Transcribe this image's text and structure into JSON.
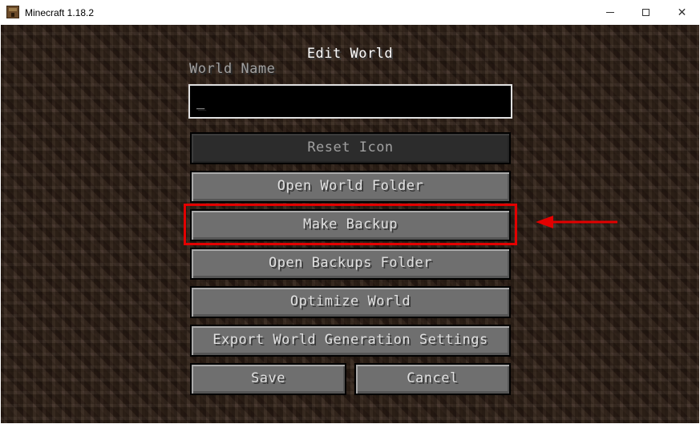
{
  "window": {
    "title": "Minecraft 1.18.2",
    "icon": "minecraft-block-icon",
    "controls": {
      "minimize_icon": "minimize-icon",
      "maximize_icon": "maximize-icon",
      "close_glyph": "✕"
    }
  },
  "screen": {
    "title": "Edit World",
    "world_name_label": "World Name",
    "world_name_value": "_"
  },
  "buttons": {
    "reset_icon": "Reset Icon",
    "open_world_folder": "Open World Folder",
    "make_backup": "Make Backup",
    "open_backups_folder": "Open Backups Folder",
    "optimize_world": "Optimize World",
    "export_world_generation_settings": "Export World Generation Settings",
    "save": "Save",
    "cancel": "Cancel"
  },
  "annotation": {
    "highlight_color": "#e30000",
    "target": "make_backup"
  },
  "colors": {
    "button_face": "#6f6f6f",
    "button_disabled": "#2c2c2c",
    "text": "#e0e0e0",
    "label_gray": "#a0a0a0"
  }
}
